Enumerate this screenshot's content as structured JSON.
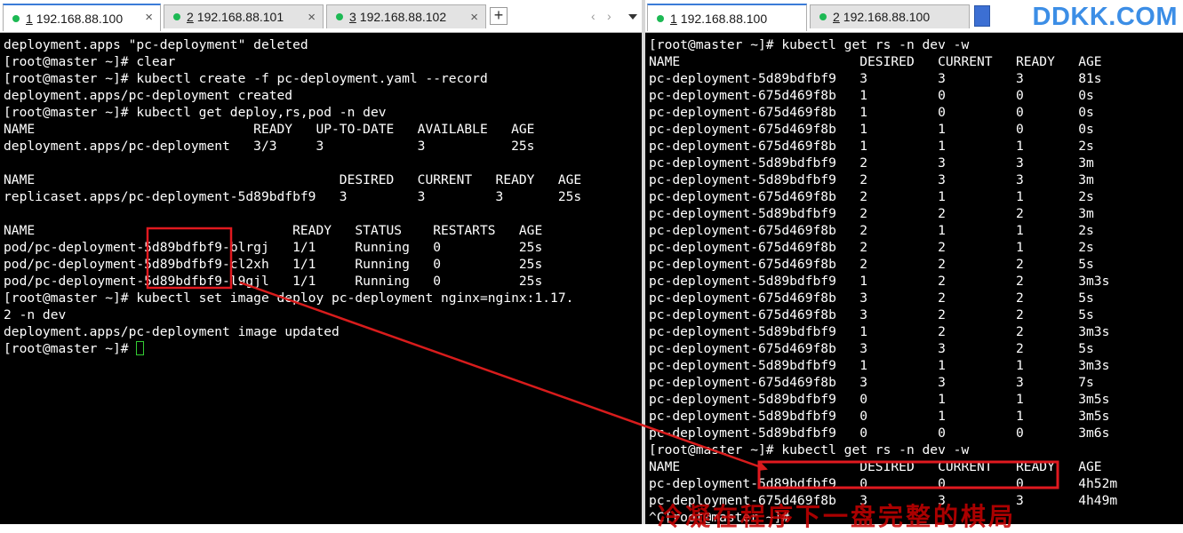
{
  "left": {
    "tabs": [
      {
        "num": "1",
        "host": "192.168.88.100",
        "close": "×",
        "active": true
      },
      {
        "num": "2",
        "host": "192.168.88.101",
        "close": "×",
        "active": false
      },
      {
        "num": "3",
        "host": "192.168.88.102",
        "close": "×",
        "active": false
      }
    ],
    "add_tab": "+",
    "nav_prev": "‹",
    "nav_next": "›",
    "lines": [
      "deployment.apps \"pc-deployment\" deleted",
      "[root@master ~]# clear",
      "[root@master ~]# kubectl create -f pc-deployment.yaml --record",
      "deployment.apps/pc-deployment created",
      "[root@master ~]# kubectl get deploy,rs,pod -n dev",
      "NAME                            READY   UP-TO-DATE   AVAILABLE   AGE",
      "deployment.apps/pc-deployment   3/3     3            3           25s",
      "",
      "NAME                                       DESIRED   CURRENT   READY   AGE",
      "replicaset.apps/pc-deployment-5d89bdfbf9   3         3         3       25s",
      "",
      "NAME                                 READY   STATUS    RESTARTS   AGE",
      "pod/pc-deployment-5d89bdfbf9-blrgj   1/1     Running   0          25s",
      "pod/pc-deployment-5d89bdfbf9-cl2xh   1/1     Running   0          25s",
      "pod/pc-deployment-5d89bdfbf9-l9gjl   1/1     Running   0          25s",
      "[root@master ~]# kubectl set image deploy pc-deployment nginx=nginx:1.17.",
      "2 -n dev",
      "deployment.apps/pc-deployment image updated",
      "[root@master ~]# "
    ]
  },
  "right": {
    "tabs": [
      {
        "num": "1",
        "host": "192.168.88.100",
        "active": true
      },
      {
        "num": "2",
        "host": "192.168.88.100",
        "active": false
      }
    ],
    "watermark": "DDKK.COM",
    "lines": [
      "[root@master ~]# kubectl get rs -n dev -w",
      "NAME                       DESIRED   CURRENT   READY   AGE",
      "pc-deployment-5d89bdfbf9   3         3         3       81s",
      "pc-deployment-675d469f8b   1         0         0       0s",
      "pc-deployment-675d469f8b   1         0         0       0s",
      "pc-deployment-675d469f8b   1         1         0       0s",
      "pc-deployment-675d469f8b   1         1         1       2s",
      "pc-deployment-5d89bdfbf9   2         3         3       3m",
      "pc-deployment-5d89bdfbf9   2         3         3       3m",
      "pc-deployment-675d469f8b   2         1         1       2s",
      "pc-deployment-5d89bdfbf9   2         2         2       3m",
      "pc-deployment-675d469f8b   2         1         1       2s",
      "pc-deployment-675d469f8b   2         2         1       2s",
      "pc-deployment-675d469f8b   2         2         2       5s",
      "pc-deployment-5d89bdfbf9   1         2         2       3m3s",
      "pc-deployment-675d469f8b   3         2         2       5s",
      "pc-deployment-675d469f8b   3         2         2       5s",
      "pc-deployment-5d89bdfbf9   1         2         2       3m3s",
      "pc-deployment-675d469f8b   3         3         2       5s",
      "pc-deployment-5d89bdfbf9   1         1         1       3m3s",
      "pc-deployment-675d469f8b   3         3         3       7s",
      "pc-deployment-5d89bdfbf9   0         1         1       3m5s",
      "pc-deployment-5d89bdfbf9   0         1         1       3m5s",
      "pc-deployment-5d89bdfbf9   0         0         0       3m6s",
      "[root@master ~]# kubectl get rs -n dev -w",
      "NAME                       DESIRED   CURRENT   READY   AGE",
      "pc-deployment-5d89bdfbf9   0         0         0       4h52m",
      "pc-deployment-675d469f8b   3         3         3       4h49m",
      "^C[root@master ~]# "
    ],
    "banner": "冷凝在程序下一盘完整的棋局"
  },
  "annotations": {
    "box_color": "#e0191f",
    "arrow_color": "#d81c1c"
  }
}
